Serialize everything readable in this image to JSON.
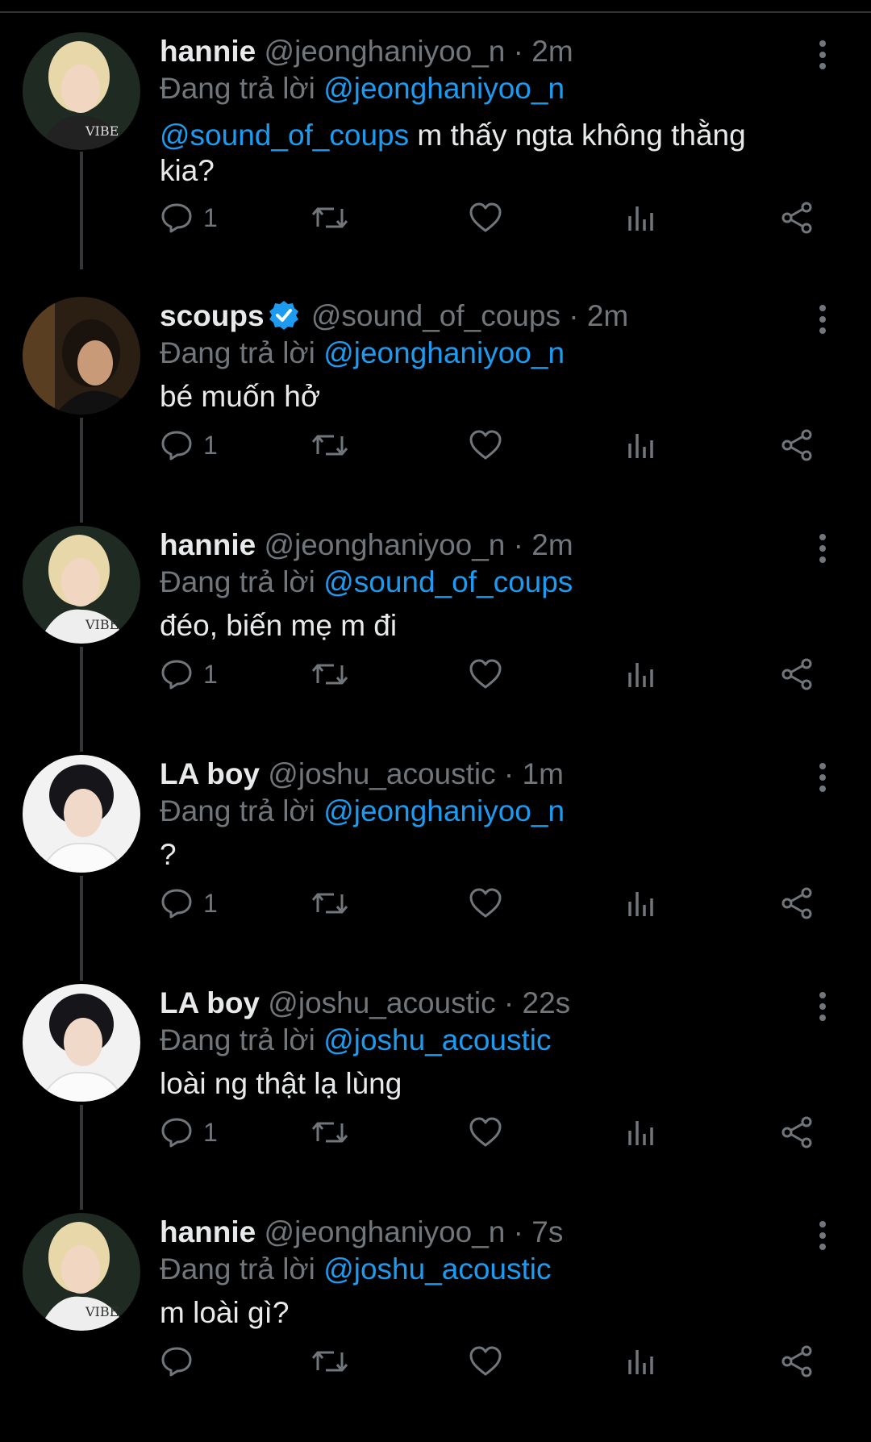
{
  "reply_prefix": "Đang trả lời",
  "icons": {
    "reply": "reply-icon",
    "retweet": "retweet-icon",
    "like": "heart-icon",
    "views": "analytics-icon",
    "share": "share-icon",
    "more": "more-vertical-icon",
    "verified": "verified-badge-icon"
  },
  "colors": {
    "accent": "#1d9bf0",
    "muted": "#71767b",
    "text": "#e7e9ea",
    "background": "#000000"
  },
  "tweets": [
    {
      "name": "hannie",
      "handle": "@jeonghaniyoo_n",
      "time": "· 2m",
      "reply_to": "@jeonghaniyoo_n",
      "mention": "@sound_of_coups",
      "text": " m thấy ngta không thằng kia?",
      "reply_count": "1",
      "verified": false
    },
    {
      "name": "scoups",
      "handle": "@sound_of_coups",
      "time": "· 2m",
      "reply_to": "@jeonghaniyoo_n",
      "mention": "",
      "text": "bé muốn hở",
      "reply_count": "1",
      "verified": true
    },
    {
      "name": "hannie",
      "handle": "@jeonghaniyoo_n",
      "time": "· 2m",
      "reply_to": "@sound_of_coups",
      "mention": "",
      "text": "đéo, biến mẹ m đi",
      "reply_count": "1",
      "verified": false
    },
    {
      "name": "LA boy",
      "handle": "@joshu_acoustic",
      "time": "· 1m",
      "reply_to": "@jeonghaniyoo_n",
      "mention": "",
      "text": "?",
      "reply_count": "1",
      "verified": false
    },
    {
      "name": "LA boy",
      "handle": "@joshu_acoustic",
      "time": "· 22s",
      "reply_to": "@joshu_acoustic",
      "mention": "",
      "text": "loài ng thật lạ lùng",
      "reply_count": "1",
      "verified": false
    },
    {
      "name": "hannie",
      "handle": "@jeonghaniyoo_n",
      "time": "· 7s",
      "reply_to": "@joshu_acoustic",
      "mention": "",
      "text": "m loài gì?",
      "reply_count": "",
      "verified": false
    }
  ]
}
